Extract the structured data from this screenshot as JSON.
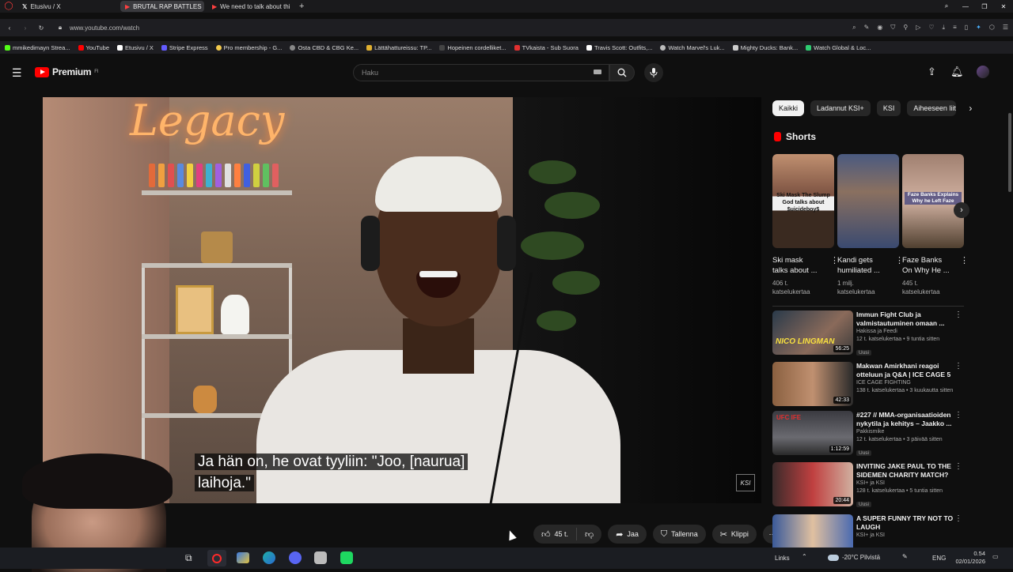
{
  "browser": {
    "tabs": [
      {
        "label": "Etusivu / X"
      },
      {
        "label": "BRUTAL RAP BATTLES"
      },
      {
        "label": "We need to talk about thi"
      }
    ],
    "url": "www.youtube.com/watch",
    "bookmarks": [
      "mmikedimayn Strea...",
      "YouTube",
      "Etusivu / X",
      "Stripe Express",
      "Pro membership - G...",
      "Osta CBD & CBG Ke...",
      "Lättähattureissu: TP...",
      "Hopeinen cordelliket...",
      "TVkaista - Sub Suora",
      "Travis Scott: Outfits,...",
      "Watch Marvel's Luk...",
      "Mighty Ducks: Bank...",
      "Watch Global & Loc..."
    ]
  },
  "youtube": {
    "logo_text": "Premium",
    "logo_sup": "FI",
    "search_placeholder": "Haku"
  },
  "video": {
    "neon_text": "Legacy",
    "caption_line1": "Ja hän on, he ovat tyyliin: \"Joo, [naurua]",
    "caption_line2": "laihoja.\"",
    "watermark": "KSI"
  },
  "actions": {
    "likes": "45 t.",
    "share": "Jaa",
    "save": "Tallenna",
    "clip": "Klippi"
  },
  "chips": [
    "Kaikki",
    "Ladannut KSI+",
    "KSI",
    "Aiheeseen liit"
  ],
  "shorts": {
    "heading": "Shorts",
    "items": [
      {
        "title_1": "Ski mask",
        "title_2": "talks about ...",
        "views_1": "406 t.",
        "views_2": "katselukertaa",
        "thumb_text": "Ski Mask The Slump God talks about $uicideboy$"
      },
      {
        "title_1": "Kandi gets",
        "title_2": "humiliated ...",
        "views_1": "1 milj.",
        "views_2": "katselukertaa",
        "thumb_text": ""
      },
      {
        "title_1": "Faze Banks",
        "title_2": "On Why He ...",
        "views_1": "445 t.",
        "views_2": "katselukertaa",
        "thumb_text": "Faze Banks Explains Why he Left Faze"
      }
    ]
  },
  "recommendations": [
    {
      "t1": "Immun Fight Club ja",
      "t2": "valmistautuminen omaan ...",
      "channel": "Hakissa ja Feedi",
      "meta": "12 t. katselukertaa • 9 tuntia sitten",
      "badge": "Uusi",
      "duration": "56:25",
      "thumb_text": "NICO LINGMAN"
    },
    {
      "t1": "Makwan Amirkhani reagoi",
      "t2": "otteluun ja Q&A | ICE CAGE 5",
      "channel": "ICE CAGE FIGHTING",
      "meta": "138 t. katselukertaa • 3 kuukautta sitten",
      "badge": "",
      "duration": "42:33",
      "thumb_text": ""
    },
    {
      "t1": "#227 // MMA-organisaatioiden",
      "t2": "nykytila ja kehitys – Jaakko ...",
      "channel": "Pakkismike",
      "meta": "12 t. katselukertaa • 3 päivää sitten",
      "badge": "Uusi",
      "duration": "1:12:59",
      "thumb_text": "UFC IFE"
    },
    {
      "t1": "INVITING JAKE PAUL TO THE",
      "t2": "SIDEMEN CHARITY MATCH?",
      "channel": "KSI+ ja KSI",
      "meta": "128 t. katselukertaa • 5 tuntia sitten",
      "badge": "Uusi",
      "duration": "20:44",
      "thumb_text": ""
    },
    {
      "t1": "A SUPER FUNNY TRY NOT TO",
      "t2": "LAUGH",
      "channel": "KSI+ ja KSI",
      "meta": "",
      "badge": "",
      "duration": "",
      "thumb_text": ""
    }
  ],
  "taskbar": {
    "links": "Links",
    "weather": "-20°C  Pilvistä",
    "lang": "ENG",
    "time": "0.54",
    "date": "02/01/2026"
  },
  "colors": {
    "yt_red": "#ff0000",
    "background": "#0f0f0f",
    "chip": "#272727"
  }
}
